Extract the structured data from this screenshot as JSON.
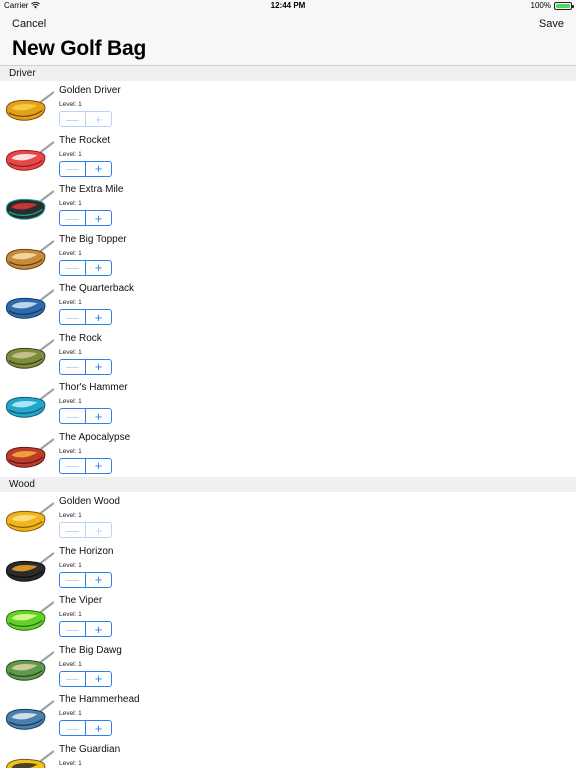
{
  "status": {
    "carrier": "Carrier",
    "time": "12:44 PM",
    "battery": "100%"
  },
  "nav": {
    "cancel_label": "Cancel",
    "save_label": "Save",
    "title": "New Golf Bag"
  },
  "sections": [
    {
      "title": "Driver",
      "clubs": [
        {
          "name": "Golden Driver",
          "level": "Level: 1",
          "colors": [
            "#e3a21a",
            "#f8d24a",
            "#7a4b08"
          ],
          "plus_enabled": false
        },
        {
          "name": "The Rocket",
          "level": "Level: 1",
          "colors": [
            "#e54848",
            "#ffffff",
            "#9b1c1c"
          ],
          "plus_enabled": true
        },
        {
          "name": "The Extra Mile",
          "level": "Level: 1",
          "colors": [
            "#2c2c2c",
            "#e23a3a",
            "#1aa39a"
          ],
          "plus_enabled": true
        },
        {
          "name": "The Big Topper",
          "level": "Level: 1",
          "colors": [
            "#c98a3a",
            "#f3e3b0",
            "#6b3d12"
          ],
          "plus_enabled": true
        },
        {
          "name": "The Quarterback",
          "level": "Level: 1",
          "colors": [
            "#2b6cb0",
            "#d9e7f7",
            "#1a365d"
          ],
          "plus_enabled": true
        },
        {
          "name": "The Rock",
          "level": "Level: 1",
          "colors": [
            "#7a8f3a",
            "#d2c79b",
            "#4a3a2a"
          ],
          "plus_enabled": true
        },
        {
          "name": "Thor's Hammer",
          "level": "Level: 1",
          "colors": [
            "#23a6c9",
            "#bff0ff",
            "#0e5c75"
          ],
          "plus_enabled": true
        },
        {
          "name": "The Apocalypse",
          "level": "Level: 1",
          "colors": [
            "#c0392b",
            "#f5b041",
            "#5a1b14"
          ],
          "plus_enabled": true
        }
      ]
    },
    {
      "title": "Wood",
      "clubs": [
        {
          "name": "Golden Wood",
          "level": "Level: 1",
          "colors": [
            "#f1b51c",
            "#ffe48a",
            "#8a5a06"
          ],
          "plus_enabled": false
        },
        {
          "name": "The Horizon",
          "level": "Level: 1",
          "colors": [
            "#2b2b2b",
            "#f5a623",
            "#0f0f0f"
          ],
          "plus_enabled": true
        },
        {
          "name": "The Viper",
          "level": "Level: 1",
          "colors": [
            "#62d12a",
            "#e7ff9b",
            "#2f6e11"
          ],
          "plus_enabled": true
        },
        {
          "name": "The Big Dawg",
          "level": "Level: 1",
          "colors": [
            "#5e9a4a",
            "#e6d2a6",
            "#2c4a22"
          ],
          "plus_enabled": true
        },
        {
          "name": "The Hammerhead",
          "level": "Level: 1",
          "colors": [
            "#4a7fb0",
            "#e9eef5",
            "#1b3a57"
          ],
          "plus_enabled": true
        },
        {
          "name": "The Guardian",
          "level": "Level: 1",
          "colors": [
            "#f2c21b",
            "#2b2b2b",
            "#7a5a06"
          ],
          "plus_enabled": true
        }
      ]
    }
  ],
  "stepper": {
    "minus_symbol": "—",
    "plus_symbol": "+"
  }
}
